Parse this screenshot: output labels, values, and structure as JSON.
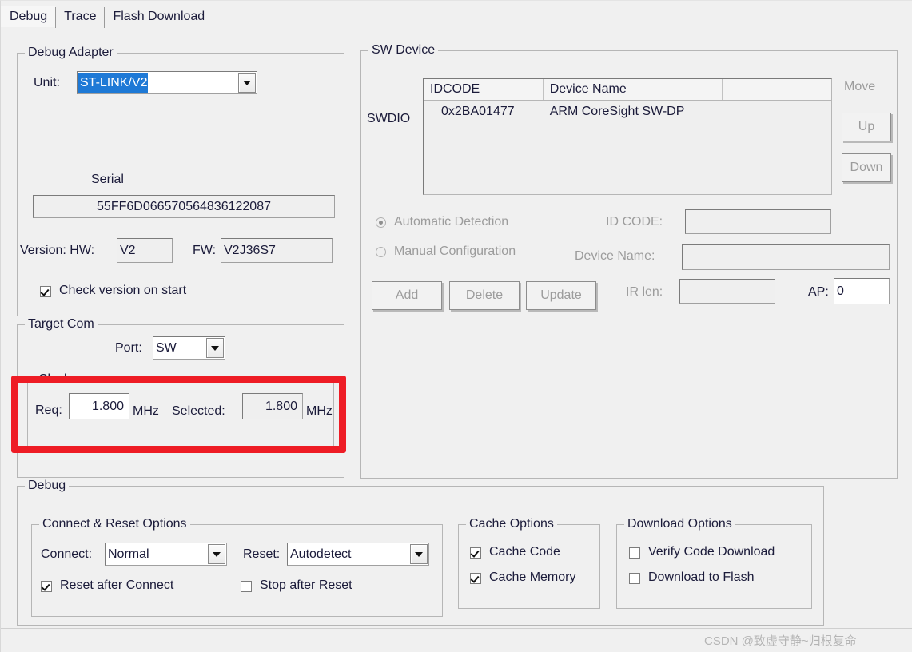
{
  "tabs": [
    {
      "label": "Debug",
      "active": true
    },
    {
      "label": "Trace",
      "active": false
    },
    {
      "label": "Flash Download",
      "active": false
    }
  ],
  "debug_adapter": {
    "group_label": "Debug Adapter",
    "unit_label": "Unit:",
    "unit_value": "ST-LINK/V2",
    "serial_label": "Serial",
    "serial_value": "55FF6D066570564836122087",
    "version_label": "Version: HW:",
    "hw_value": "V2",
    "fw_label": "FW:",
    "fw_value": "V2J36S7",
    "check_version_label": "Check version on start",
    "check_version_checked": true
  },
  "target_com": {
    "group_label": "Target Com",
    "port_label": "Port:",
    "port_value": "SW",
    "clock_label": "Clock:",
    "req_label": "Req:",
    "req_value": "1.800",
    "req_unit": "MHz",
    "selected_label": "Selected:",
    "selected_value": "1.800",
    "selected_unit": "MHz"
  },
  "sw_device": {
    "group_label": "SW Device",
    "swdio_label": "SWDIO",
    "columns": [
      "IDCODE",
      "Device Name",
      ""
    ],
    "rows": [
      {
        "idcode": "0x2BA01477",
        "device_name": "ARM CoreSight SW-DP",
        "extra": ""
      }
    ],
    "move_label": "Move",
    "up_label": "Up",
    "down_label": "Down",
    "automatic_detection_label": "Automatic Detection",
    "automatic_detection_selected": true,
    "manual_configuration_label": "Manual Configuration",
    "manual_configuration_selected": false,
    "id_code_label": "ID CODE:",
    "id_code_value": "",
    "device_name_label": "Device Name:",
    "device_name_value": "",
    "add_label": "Add",
    "delete_label": "Delete",
    "update_label": "Update",
    "ir_len_label": "IR len:",
    "ir_len_value": "",
    "ap_label": "AP:",
    "ap_value": "0"
  },
  "debug_section": {
    "group_label": "Debug",
    "connect_reset": {
      "group_label": "Connect & Reset Options",
      "connect_label": "Connect:",
      "connect_value": "Normal",
      "reset_label": "Reset:",
      "reset_value": "Autodetect",
      "reset_after_connect_label": "Reset after Connect",
      "reset_after_connect_checked": true,
      "stop_after_reset_label": "Stop after Reset",
      "stop_after_reset_checked": false
    },
    "cache": {
      "group_label": "Cache Options",
      "cache_code_label": "Cache Code",
      "cache_code_checked": true,
      "cache_memory_label": "Cache Memory",
      "cache_memory_checked": true
    },
    "download": {
      "group_label": "Download Options",
      "verify_code_download_label": "Verify Code Download",
      "verify_code_download_checked": false,
      "download_to_flash_label": "Download to Flash",
      "download_to_flash_checked": false
    }
  },
  "annotation": {
    "highlight_color": "#ee1c25"
  },
  "watermark": {
    "text": "CSDN @致虚守静~归根复命"
  }
}
